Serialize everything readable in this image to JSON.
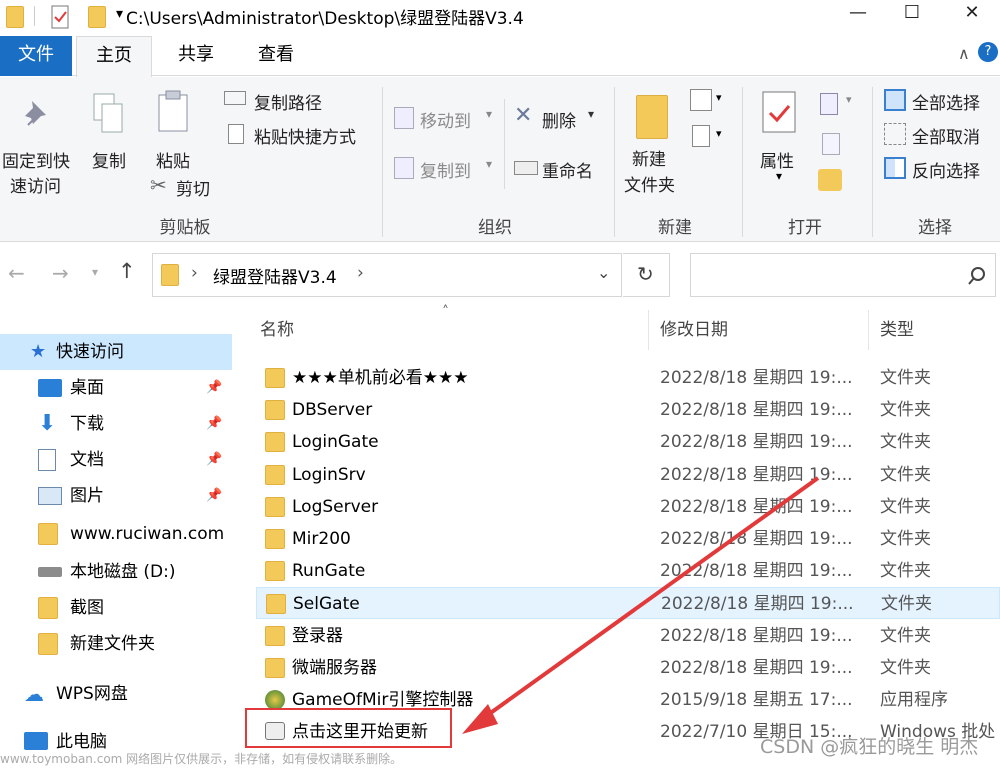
{
  "title": {
    "path": "C:\\Users\\Administrator\\Desktop\\绿盟登陆器V3.4",
    "minimize": "—",
    "maximize": "☐",
    "close": "✕"
  },
  "tabs": {
    "file": "文件",
    "home": "主页",
    "share": "共享",
    "view": "查看"
  },
  "ribbon": {
    "clipboard": {
      "pin": "固定到快",
      "pin2": "速访问",
      "copy": "复制",
      "paste": "粘贴",
      "copy_path": "复制路径",
      "paste_shortcut": "粘贴快捷方式",
      "cut": "剪切",
      "label": "剪贴板"
    },
    "organize": {
      "move_to": "移动到",
      "copy_to": "复制到",
      "delete": "删除",
      "rename": "重命名",
      "label": "组织"
    },
    "new": {
      "new_folder": "新建",
      "new_folder2": "文件夹",
      "label": "新建"
    },
    "open": {
      "properties": "属性",
      "label": "打开"
    },
    "select": {
      "select_all": "全部选择",
      "select_none": "全部取消",
      "invert": "反向选择",
      "label": "选择"
    }
  },
  "address": {
    "crumb": "绿盟登陆器V3.4",
    "sep": "›"
  },
  "nav": {
    "quick_access": "快速访问",
    "items": [
      {
        "label": "桌面",
        "pinned": true
      },
      {
        "label": "下载",
        "pinned": true
      },
      {
        "label": "文档",
        "pinned": true
      },
      {
        "label": "图片",
        "pinned": true
      },
      {
        "label": "www.ruciwan.com",
        "pinned": false
      },
      {
        "label": "本地磁盘 (D:)",
        "pinned": false
      },
      {
        "label": "截图",
        "pinned": false
      },
      {
        "label": "新建文件夹",
        "pinned": false
      }
    ],
    "wps": "WPS网盘",
    "pc": "此电脑"
  },
  "columns": {
    "name": "名称",
    "date": "修改日期",
    "type": "类型"
  },
  "files": [
    {
      "name": "★★★单机前必看★★★",
      "date": "2022/8/18 星期四 19:...",
      "type": "文件夹",
      "icon": "folder"
    },
    {
      "name": "DBServer",
      "date": "2022/8/18 星期四 19:...",
      "type": "文件夹",
      "icon": "folder"
    },
    {
      "name": "LoginGate",
      "date": "2022/8/18 星期四 19:...",
      "type": "文件夹",
      "icon": "folder"
    },
    {
      "name": "LoginSrv",
      "date": "2022/8/18 星期四 19:...",
      "type": "文件夹",
      "icon": "folder"
    },
    {
      "name": "LogServer",
      "date": "2022/8/18 星期四 19:...",
      "type": "文件夹",
      "icon": "folder"
    },
    {
      "name": "Mir200",
      "date": "2022/8/18 星期四 19:...",
      "type": "文件夹",
      "icon": "folder"
    },
    {
      "name": "RunGate",
      "date": "2022/8/18 星期四 19:...",
      "type": "文件夹",
      "icon": "folder"
    },
    {
      "name": "SelGate",
      "date": "2022/8/18 星期四 19:...",
      "type": "文件夹",
      "icon": "folder",
      "selected": true
    },
    {
      "name": "登录器",
      "date": "2022/8/18 星期四 19:...",
      "type": "文件夹",
      "icon": "folder"
    },
    {
      "name": "微端服务器",
      "date": "2022/8/18 星期四 19:...",
      "type": "文件夹",
      "icon": "folder"
    },
    {
      "name": "GameOfMir引擎控制器",
      "date": "2015/9/18 星期五 17:...",
      "type": "应用程序",
      "icon": "app"
    },
    {
      "name": "点击这里开始更新",
      "date": "2022/7/10 星期日 15:...",
      "type": "Windows 批处",
      "icon": "batch"
    }
  ],
  "watermark": "www.toymoban.com 网络图片仅供展示，非存储，如有侵权请联系删除。",
  "watermark2": "CSDN @疯狂的晓生 明杰",
  "colors": {
    "accent": "#1a6fc4",
    "arrow": "#e23a3a",
    "selected": "#e5f3ff",
    "folder": "#f3c95a"
  }
}
